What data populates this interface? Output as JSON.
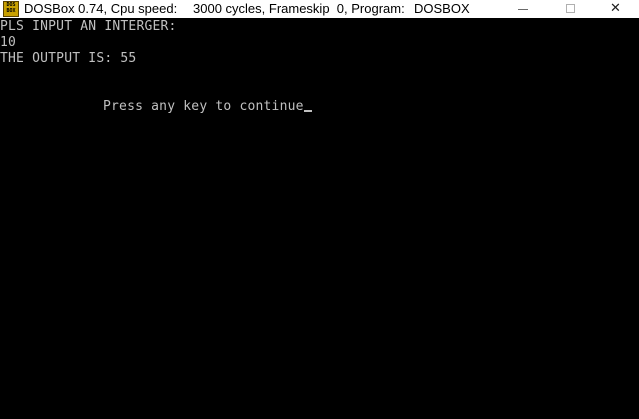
{
  "window": {
    "title_app": "DOSBox 0.74, Cpu speed:",
    "title_cycles": "3000 cycles, Frameskip  0, Program:",
    "title_program": "DOSBOX",
    "icon": "dosbox-icon",
    "icon_label": "DOS BOX",
    "controls": {
      "minimize_icon": "minimize-icon",
      "maximize_icon": "maximize-icon",
      "close_icon": "close-icon",
      "close_glyph": "✕"
    }
  },
  "console": {
    "lines": [
      "PLS INPUT AN INTERGER:",
      "10",
      "THE OUTPUT IS: 55"
    ],
    "prompt": "Press any key to continue",
    "text_color": "#c0c0c0",
    "background_color": "#000000"
  }
}
